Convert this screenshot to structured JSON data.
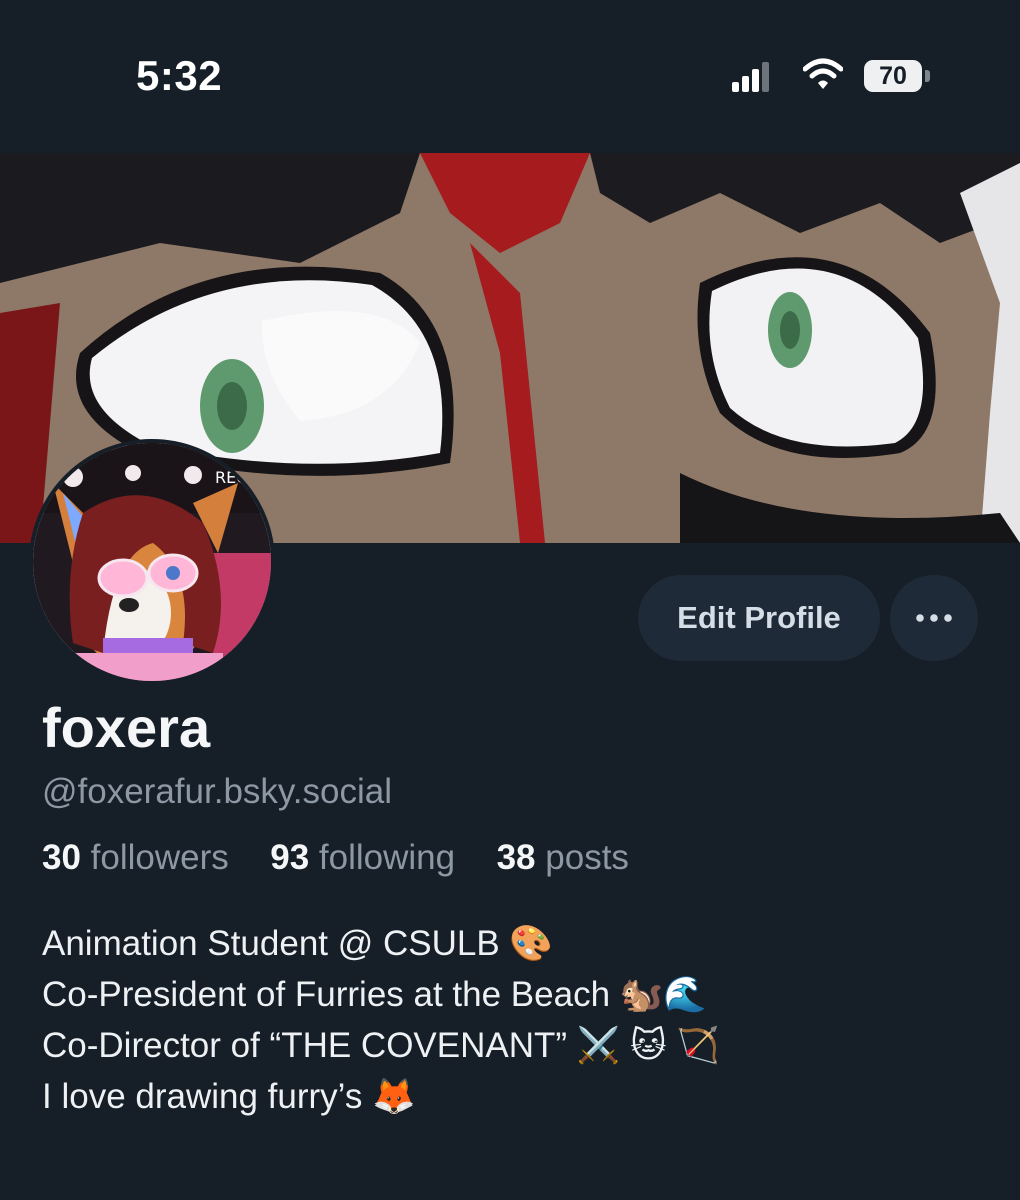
{
  "status_bar": {
    "time": "5:32",
    "battery_percent": "70",
    "icons": [
      "signal-icon",
      "wifi-icon",
      "battery-icon"
    ]
  },
  "profile": {
    "display_name": "foxera",
    "handle": "@foxerafur.bsky.social",
    "stats": [
      {
        "count": "30",
        "label": "followers"
      },
      {
        "count": "93",
        "label": "following"
      },
      {
        "count": "38",
        "label": "posts"
      }
    ],
    "bio_lines": [
      "Animation Student @ CSULB 🎨",
      "Co-President of Furries at the Beach 🐿️🌊",
      "Co-Director of “THE COVENANT” ⚔️ 🐱 🏹",
      "I love drawing furry’s 🦊"
    ]
  },
  "actions": {
    "edit_profile_label": "Edit Profile",
    "more_label": "···"
  },
  "avatar_text": {
    "rec_label": "REC"
  },
  "colors": {
    "background": "#161e27",
    "button_background": "#1e2a37",
    "muted_text": "#8d98a5"
  }
}
